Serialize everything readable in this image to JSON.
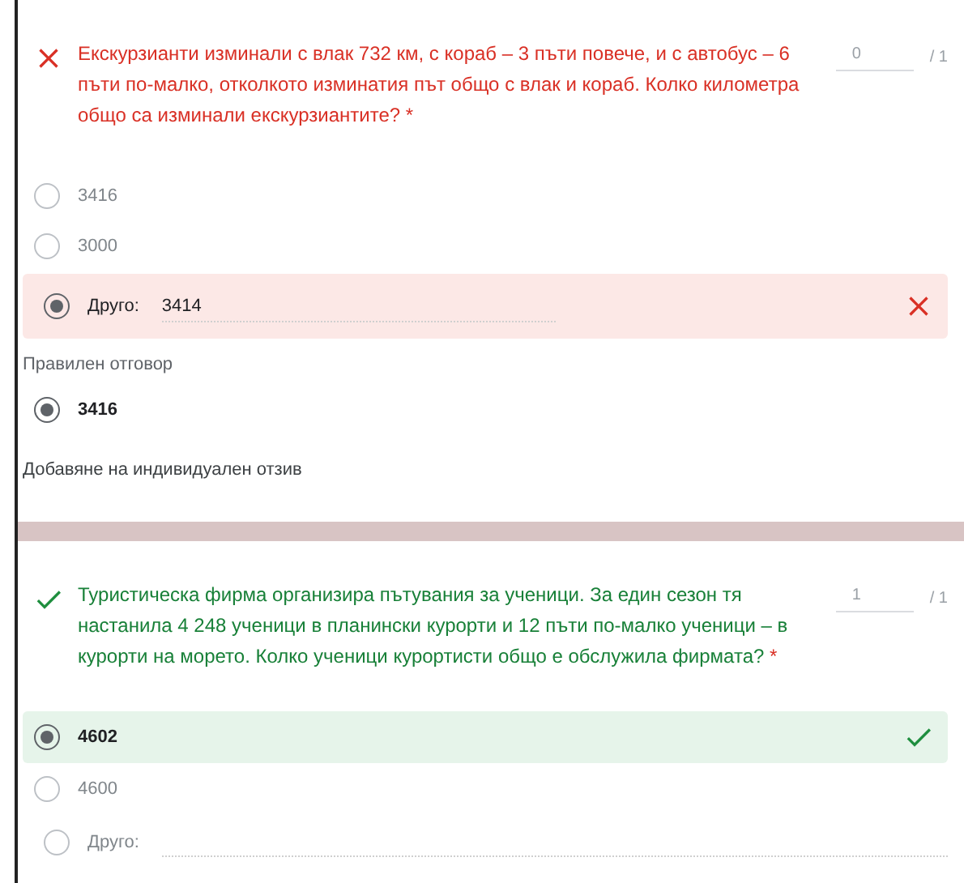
{
  "questions": [
    {
      "correct": false,
      "text": "Екскурзианти изминали с влак 732 км, с кораб – 3 пъти повече, и с автобус – 6 пъти по-малко, отколкото изминатия път общо с влак и кораб. Колко километра общо са изминали екскурзиантите?",
      "required_mark": "*",
      "score": "0",
      "max": "/ 1",
      "options": [
        {
          "kind": "choice",
          "label": "3416",
          "selected": false
        },
        {
          "kind": "choice",
          "label": "3000",
          "selected": false
        },
        {
          "kind": "other",
          "label": "Друго:",
          "value": "3414",
          "selected": true,
          "correct": false
        }
      ],
      "correct_answer": {
        "heading": "Правилен отговор",
        "label": "3416",
        "selected": true
      },
      "feedback_link": "Добавяне на индивидуален отзив"
    },
    {
      "correct": true,
      "text": "Туристическа фирма организира пътувания за ученици. За един сезон тя настанила 4 248 ученици в планински курорти и 12 пъти по-малко ученици – в курорти на морето. Колко ученици курортисти общо е обслужила фирмата?",
      "required_mark": "*",
      "score": "1",
      "max": "/ 1",
      "options": [
        {
          "kind": "choice",
          "label": "4602",
          "selected": true,
          "correct": true
        },
        {
          "kind": "choice",
          "label": "4600",
          "selected": false
        },
        {
          "kind": "other",
          "label": "Друго:",
          "selected": false
        }
      ]
    }
  ]
}
